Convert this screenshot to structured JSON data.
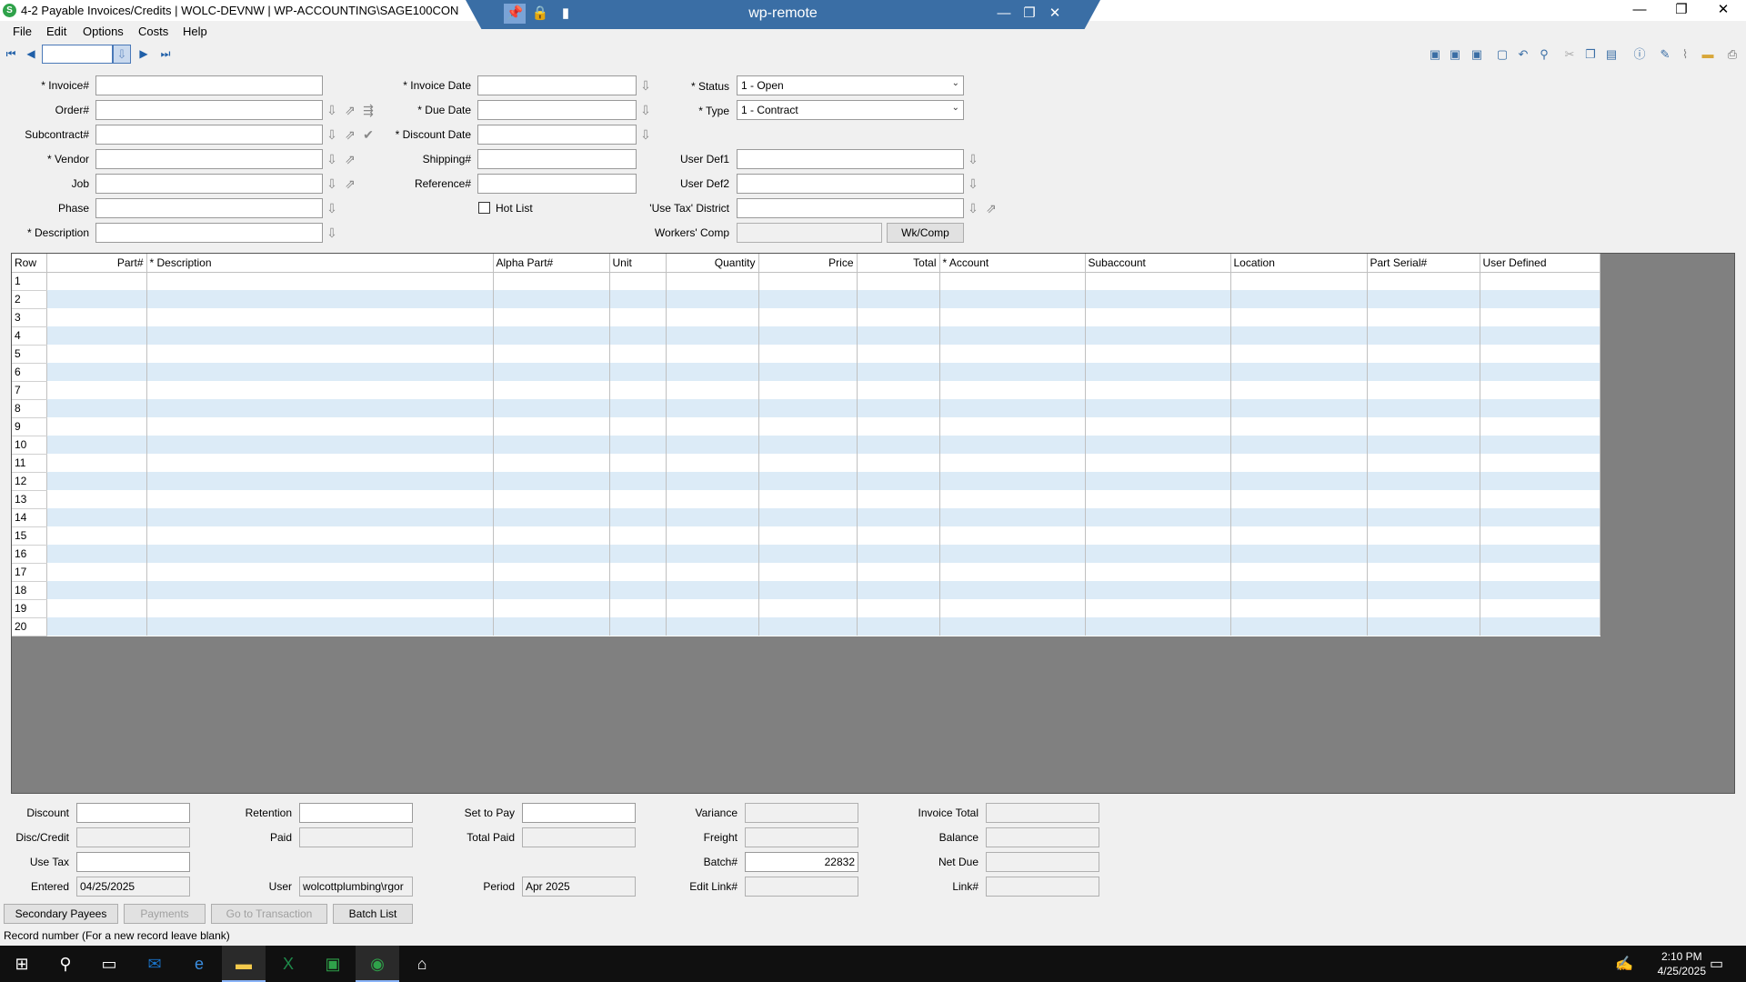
{
  "window": {
    "title": "4-2 Payable Invoices/Credits  |  WOLC-DEVNW  |  WP-ACCOUNTING\\SAGE100CON",
    "app_icon": "sage-icon",
    "minimize": "—",
    "restore": "❐",
    "close": "✕"
  },
  "remote": {
    "title": "wp-remote",
    "icons": [
      "pin-icon",
      "lock-icon",
      "signal-icon"
    ],
    "minimize": "—",
    "restore": "❐",
    "close": "✕"
  },
  "menu": [
    "File",
    "Edit",
    "Options",
    "Costs",
    "Help"
  ],
  "nav": {
    "record_value": "",
    "first": "⏮",
    "prev": "◀",
    "next": "▶",
    "last": "⏭",
    "lookup": "⇩"
  },
  "toolbar_icons": [
    "save-icon",
    "save-all-icon",
    "save-close-icon",
    "new-icon",
    "undo-icon",
    "find-icon",
    "cut-icon",
    "copy-icon",
    "paste-icon",
    "info-icon",
    "edit-icon",
    "attach-icon",
    "folder-icon",
    "print-icon"
  ],
  "form": {
    "invoice_label": "* Invoice#",
    "order_label": "Order#",
    "subcontract_label": "Subcontract#",
    "vendor_label": "* Vendor",
    "job_label": "Job",
    "phase_label": "Phase",
    "description_label": "* Description",
    "invoice_date_label": "* Invoice Date",
    "due_date_label": "* Due Date",
    "discount_date_label": "* Discount Date",
    "shipping_label": "Shipping#",
    "reference_label": "Reference#",
    "hot_list_label": "Hot List",
    "status_label": "* Status",
    "status_value": "1 - Open",
    "type_label": "* Type",
    "type_value": "1 - Contract",
    "user_def1_label": "User Def1",
    "user_def2_label": "User Def2",
    "use_tax_district_label": "'Use Tax' District",
    "workers_comp_label": "Workers' Comp",
    "wkcomp_button": "Wk/Comp"
  },
  "grid": {
    "columns": [
      "Row",
      "Part#",
      "* Description",
      "Alpha Part#",
      "Unit",
      "Quantity",
      "Price",
      "Total",
      "* Account",
      "Subaccount",
      "Location",
      "Part Serial#",
      "User Defined"
    ],
    "rows": [
      "1",
      "2",
      "3",
      "4",
      "5",
      "6",
      "7",
      "8",
      "9",
      "10",
      "11",
      "12",
      "13",
      "14",
      "15",
      "16",
      "17",
      "18",
      "19",
      "20"
    ]
  },
  "totals": {
    "discount_label": "Discount",
    "disc_credit_label": "Disc/Credit",
    "use_tax_label": "Use Tax",
    "entered_label": "Entered",
    "entered_value": "04/25/2025",
    "retention_label": "Retention",
    "paid_label": "Paid",
    "user_label": "User",
    "user_value": "wolcottplumbing\\rgor",
    "set_to_pay_label": "Set to Pay",
    "total_paid_label": "Total Paid",
    "period_label": "Period",
    "period_value": "Apr 2025",
    "variance_label": "Variance",
    "freight_label": "Freight",
    "batch_label": "Batch#",
    "batch_value": "22832",
    "edit_link_label": "Edit Link#",
    "invoice_total_label": "Invoice Total",
    "balance_label": "Balance",
    "net_due_label": "Net Due",
    "link_label": "Link#"
  },
  "buttons": {
    "secondary_payees": "Secondary Payees",
    "payments": "Payments",
    "go_to_transaction": "Go to Transaction",
    "batch_list": "Batch List"
  },
  "status_text": "Record number (For a new record leave blank)",
  "taskbar": {
    "time": "2:10 PM",
    "date": "4/25/2025",
    "apps": [
      "start-icon",
      "search-icon",
      "task-view-icon",
      "outlook-icon",
      "edge-icon",
      "file-explorer-icon",
      "excel-icon",
      "sage-icon",
      "sage-green-icon",
      "spc-icon"
    ]
  }
}
